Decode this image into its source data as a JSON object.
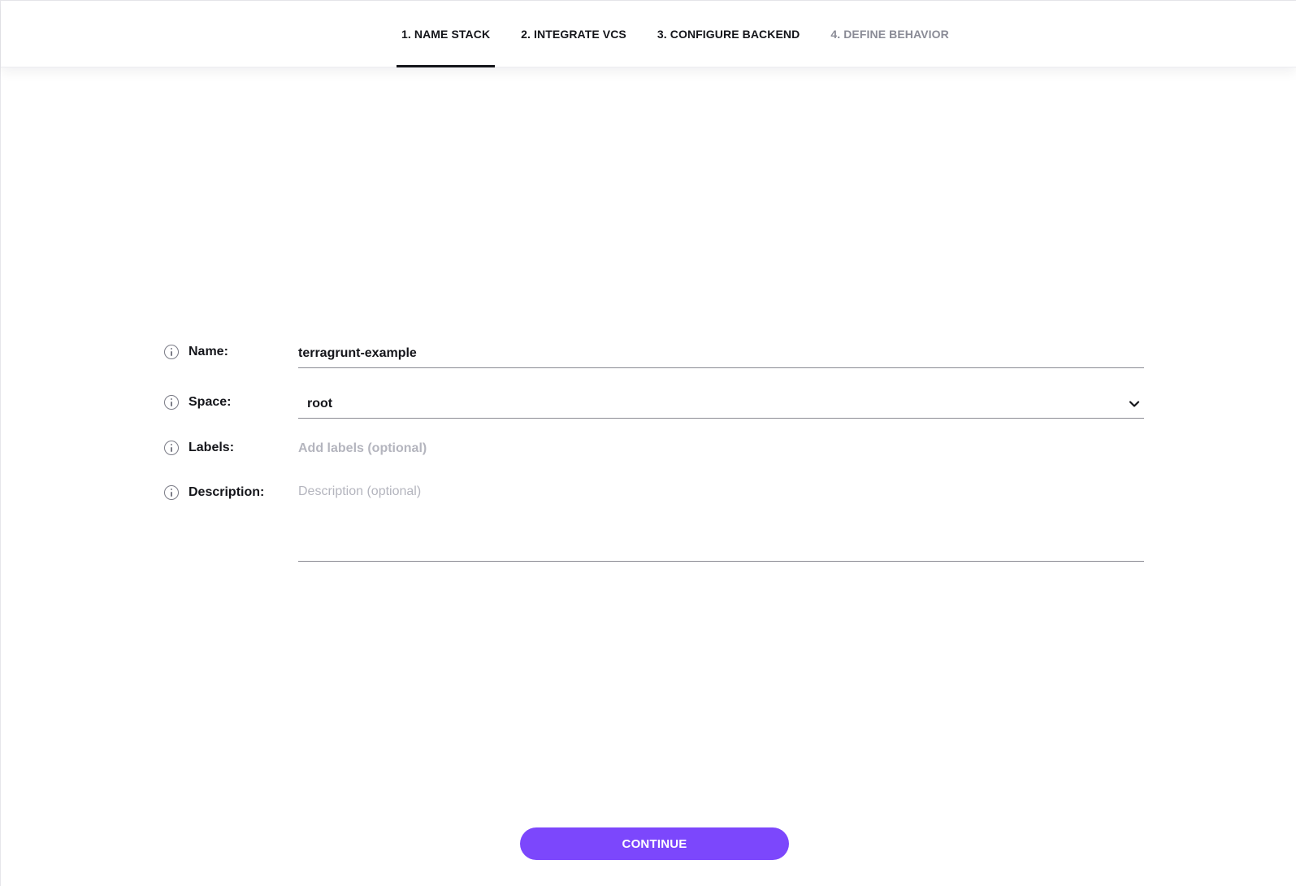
{
  "steps": [
    {
      "label": "1. NAME STACK",
      "state": "active"
    },
    {
      "label": "2. INTEGRATE VCS",
      "state": "enabled"
    },
    {
      "label": "3. CONFIGURE BACKEND",
      "state": "enabled"
    },
    {
      "label": "4. DEFINE BEHAVIOR",
      "state": "disabled"
    }
  ],
  "form": {
    "name": {
      "label": "Name:",
      "value": "terragrunt-example"
    },
    "space": {
      "label": "Space:",
      "value": "root"
    },
    "labels": {
      "label": "Labels:",
      "placeholder": "Add labels (optional)"
    },
    "description": {
      "label": "Description:",
      "placeholder": "Description (optional)"
    }
  },
  "actions": {
    "continue_label": "CONTINUE"
  },
  "icons": {
    "field_info": "info-circle-icon",
    "space_dropdown": "chevron-down-icon"
  },
  "colors": {
    "accent": "#7c47fc",
    "text": "#14151a",
    "disabled_tab": "#8a8b96",
    "placeholder": "#b4b5be"
  }
}
